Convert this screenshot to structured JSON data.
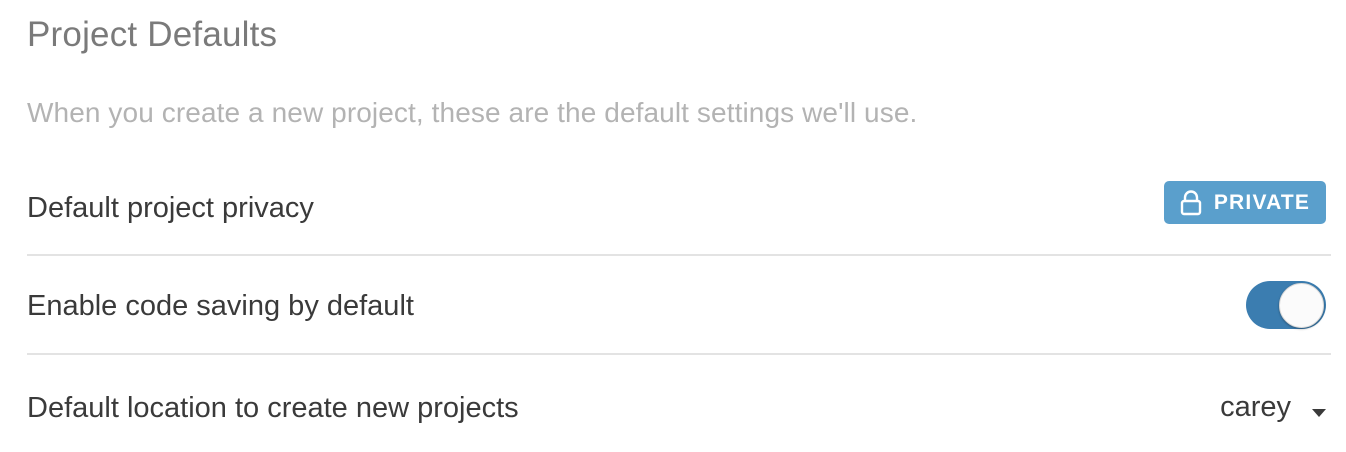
{
  "section": {
    "title": "Project Defaults",
    "subtitle": "When you create a new project, these are the default settings we'll use."
  },
  "settings": {
    "privacy": {
      "label": "Default project privacy",
      "badge_text": "PRIVATE",
      "badge_icon": "lock-icon"
    },
    "code_saving": {
      "label": "Enable code saving by default",
      "enabled": true
    },
    "location": {
      "label": "Default location to create new projects",
      "value": "carey",
      "icon": "caret-down-icon"
    }
  },
  "colors": {
    "badge_bg": "#5a9fcc",
    "toggle_on": "#3b7db0",
    "title": "#7a7a7a",
    "subtitle": "#b3b3b3",
    "text": "#3a3a3a",
    "divider": "#e3e3e3"
  }
}
